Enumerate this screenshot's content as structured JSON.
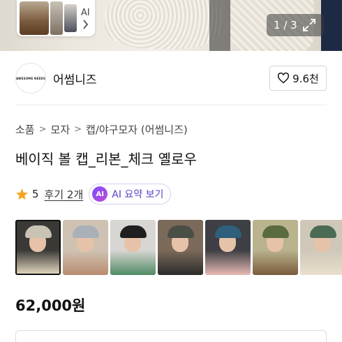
{
  "hero": {
    "ai_label": "AI",
    "counter_current": "1",
    "counter_separator": "/",
    "counter_total": "3"
  },
  "shop": {
    "logo_text": "AWESOME NEEDS",
    "name": "어썸니즈",
    "follow_count": "9.6천"
  },
  "breadcrumb": [
    "소품",
    "모자",
    "캡/야구모자 (어썸니즈)"
  ],
  "product": {
    "title": "베이직 볼 캡_리본_체크 옐로우",
    "rating": "5",
    "reviews": "후기 2개",
    "ai_summary_badge": "AI",
    "ai_summary_label": "AI 요약 보기",
    "price": "62,000원"
  },
  "thumbnails": [
    {
      "cap": "#c9c3b4",
      "bg": "#3a3936",
      "body": "#e9dcc4"
    },
    {
      "cap": "#a9b0b8",
      "bg": "#cfc2b2",
      "body": "#b98c70"
    },
    {
      "cap": "#1f1f1f",
      "bg": "#d8d6d2",
      "body": "#4f8a63"
    },
    {
      "cap": "#4a4f46",
      "bg": "#7b6a5a",
      "body": "#2b2b2b"
    },
    {
      "cap": "#2f5f7a",
      "bg": "#3d3f44",
      "body": "#e7b9b4"
    },
    {
      "cap": "#5a6b3e",
      "bg": "#b9b38e",
      "body": "#7a5a3a"
    },
    {
      "cap": "#4c6b55",
      "bg": "#cfc8b8",
      "body": "#e8dfcc"
    }
  ],
  "colors": {
    "ai_accent": "#5b3ec7",
    "star": "#f5a623"
  }
}
